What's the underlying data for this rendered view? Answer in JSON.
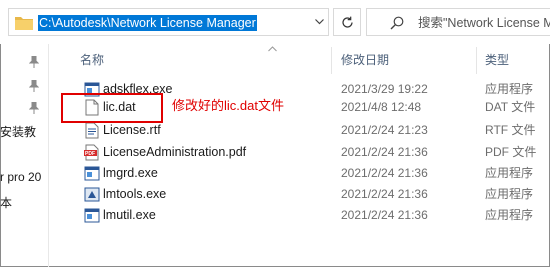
{
  "address_bar": {
    "path": "C:\\Autodesk\\Network License Manager"
  },
  "search": {
    "placeholder": "搜索\"Network License M"
  },
  "nav_pane": {
    "items": [
      "安装教",
      "r pro 20",
      "本"
    ]
  },
  "columns": {
    "name": "名称",
    "date": "修改日期",
    "type": "类型"
  },
  "files": [
    {
      "name": "adskflex.exe",
      "date": "2021/3/29 19:22",
      "type": "应用程序",
      "icon": "exe-icon"
    },
    {
      "name": "lic.dat",
      "date": "2021/4/8 12:48",
      "type": "DAT 文件",
      "icon": "file-icon"
    },
    {
      "name": "License.rtf",
      "date": "2021/2/24 21:23",
      "type": "RTF 文件",
      "icon": "rtf-icon"
    },
    {
      "name": "LicenseAdministration.pdf",
      "date": "2021/2/24 21:36",
      "type": "PDF 文件",
      "icon": "pdf-icon"
    },
    {
      "name": "lmgrd.exe",
      "date": "2021/2/24 21:36",
      "type": "应用程序",
      "icon": "exe-icon"
    },
    {
      "name": "lmtools.exe",
      "date": "2021/2/24 21:36",
      "type": "应用程序",
      "icon": "lmtools-icon"
    },
    {
      "name": "lmutil.exe",
      "date": "2021/2/24 21:36",
      "type": "应用程序",
      "icon": "exe-icon"
    }
  ],
  "annotation": {
    "text": "修改好的lic.dat文件",
    "color": "#e00000"
  },
  "colors": {
    "selection": "#0078d7",
    "header_text": "#4c607a"
  }
}
